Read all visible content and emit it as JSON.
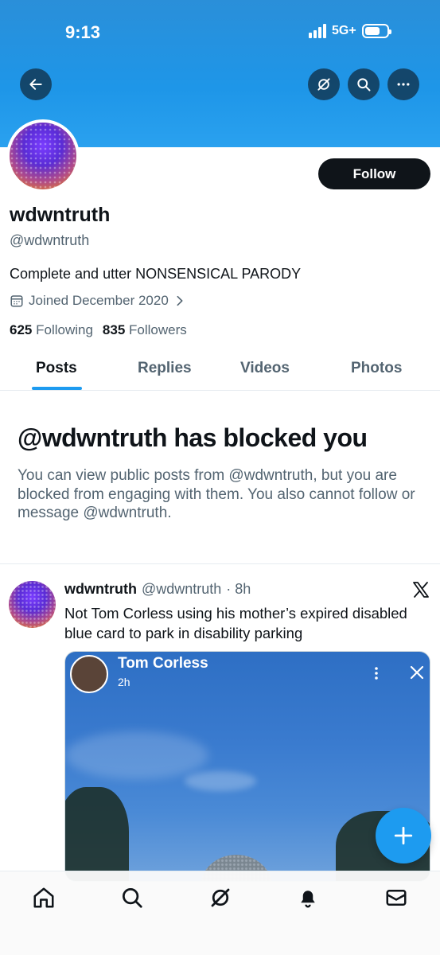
{
  "status_bar": {
    "time": "9:13",
    "network": "5G+"
  },
  "header": {
    "icons": [
      "back-arrow-icon",
      "grok-icon",
      "search-icon",
      "more-icon"
    ]
  },
  "profile": {
    "display_name": "wdwntruth",
    "handle": "@wdwntruth",
    "bio": "Complete and utter NONSENSICAL PARODY",
    "joined": "Joined December 2020",
    "following_count": "625",
    "following_label": "Following",
    "followers_count": "835",
    "followers_label": "Followers",
    "follow_label": "Follow"
  },
  "tabs": [
    {
      "label": "Posts",
      "active": true
    },
    {
      "label": "Replies",
      "active": false
    },
    {
      "label": "Videos",
      "active": false
    },
    {
      "label": "Photos",
      "active": false
    }
  ],
  "blocked": {
    "title": "@wdwntruth has blocked you",
    "body": "You can view public posts from @wdwntruth, but you are blocked from engaging with them. You also cannot follow or message @wdwntruth."
  },
  "post": {
    "name": "wdwntruth",
    "handle": "@wdwntruth",
    "time": "· 8h",
    "text": "Not Tom Corless using his mother’s expired disabled blue card to park in disability parking",
    "media": {
      "name": "Tom Corless",
      "time": "2h"
    }
  },
  "bottom_nav": [
    "home-icon",
    "search-icon",
    "grok-icon",
    "notifications-icon",
    "messages-icon"
  ],
  "colors": {
    "accent": "#1d9bf0",
    "text": "#0f1419",
    "secondary": "#536471",
    "banner": "#1e96e8"
  }
}
